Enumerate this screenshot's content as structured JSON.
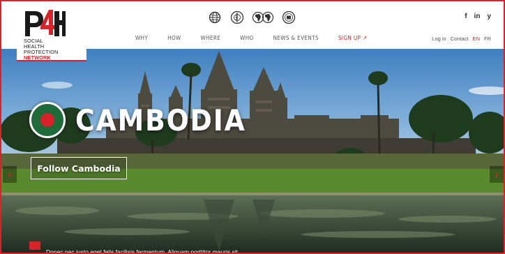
{
  "logo": {
    "mark": "P4H",
    "line1": "SOCIAL",
    "line2": "HEALTH",
    "line3": "PROTECTION",
    "network": "NETWORK"
  },
  "partners": [
    "globe-icon",
    "who-emblem-icon",
    "africa-map-icon",
    "ilo-emblem-icon"
  ],
  "social": {
    "facebook": "f",
    "linkedin": "in",
    "twitter": "y"
  },
  "nav": [
    {
      "label": "WHY"
    },
    {
      "label": "HOW"
    },
    {
      "label": "WHERE"
    },
    {
      "label": "WHO"
    },
    {
      "label": "NEWS & EVENTS"
    },
    {
      "label": "SIGN UP ↗"
    }
  ],
  "util": {
    "login": "Log in",
    "contact": "Contact",
    "lang_en": "EN",
    "lang_fr": "FR"
  },
  "hero": {
    "title": "CAMBODIA",
    "follow_label": "Follow Cambodia",
    "prev": "‹",
    "next": "›",
    "news_text": "Donec nec justo eget felis facilisis fermentum. Aliquam porttitor mauris sit"
  },
  "colors": {
    "accent": "#d8232a",
    "flag_green": "#1f6b3a"
  }
}
